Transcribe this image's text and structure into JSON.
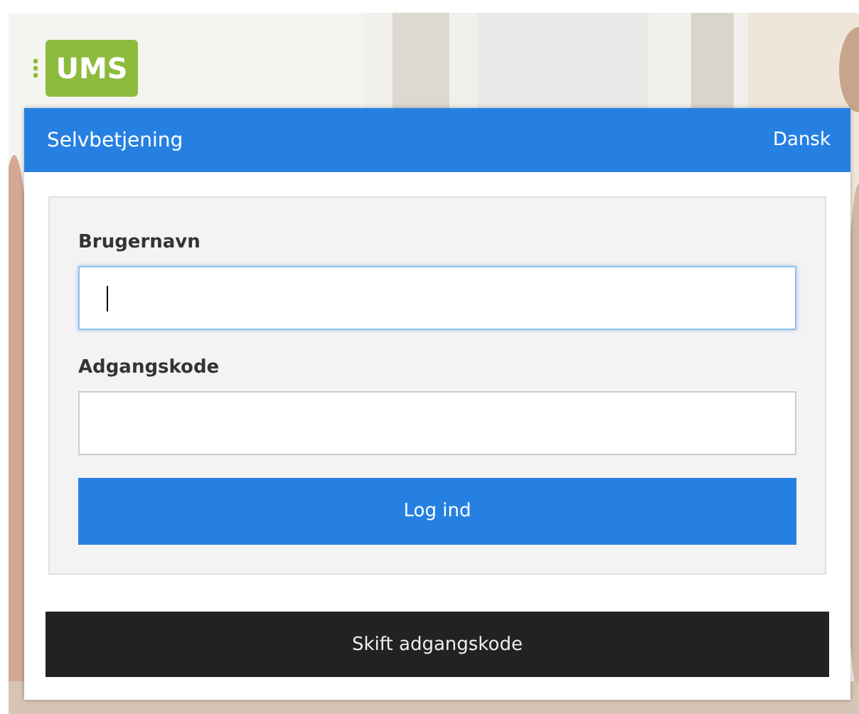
{
  "logo": {
    "text": "UMS"
  },
  "header": {
    "title": "Selvbetjening",
    "language": "Dansk"
  },
  "form": {
    "fields": [
      {
        "label": "Brugernavn",
        "focused": true
      },
      {
        "label": "Adgangskode",
        "focused": false
      }
    ],
    "submit": "Log ind"
  },
  "secondary_button": "Skift adgangskode"
}
